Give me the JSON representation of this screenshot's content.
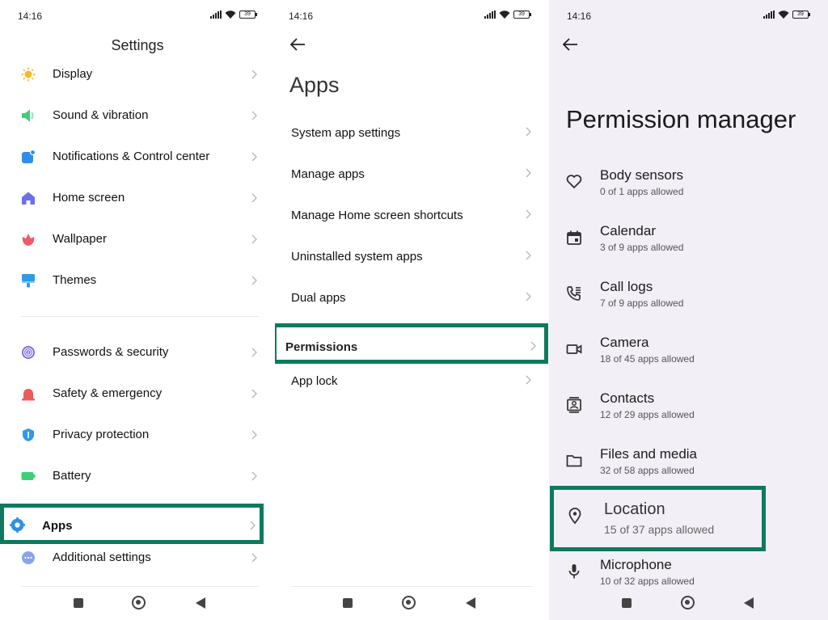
{
  "status": {
    "time": "14:16",
    "battery": "39"
  },
  "settings": {
    "title": "Settings",
    "items": [
      {
        "label": "Display",
        "icon": "sun-icon",
        "color": "#f5b82e"
      },
      {
        "label": "Sound & vibration",
        "icon": "speaker-icon",
        "color": "#3ccf7a"
      },
      {
        "label": "Notifications & Control center",
        "icon": "notification-icon",
        "color": "#2f8fe8"
      },
      {
        "label": "Home screen",
        "icon": "home-icon",
        "color": "#6b6fe8"
      },
      {
        "label": "Wallpaper",
        "icon": "flower-icon",
        "color": "#ef5a6a"
      },
      {
        "label": "Themes",
        "icon": "brush-icon",
        "color": "#2f9be8"
      },
      {
        "label": "Passwords & security",
        "icon": "fingerprint-icon",
        "color": "#7b6ee8"
      },
      {
        "label": "Safety & emergency",
        "icon": "alarm-icon",
        "color": "#ef5a5a"
      },
      {
        "label": "Privacy protection",
        "icon": "shield-icon",
        "color": "#2f9be8"
      },
      {
        "label": "Battery",
        "icon": "battery-icon",
        "color": "#3ccf7a"
      },
      {
        "label": "Apps",
        "icon": "gear-icon",
        "color": "#2f8fe8"
      },
      {
        "label": "Additional settings",
        "icon": "more-icon",
        "color": "#8aa4e8"
      }
    ]
  },
  "apps": {
    "title": "Apps",
    "items": [
      {
        "label": "System app settings"
      },
      {
        "label": "Manage apps"
      },
      {
        "label": "Manage Home screen shortcuts"
      },
      {
        "label": "Uninstalled system apps"
      },
      {
        "label": "Dual apps"
      },
      {
        "label": "Permissions"
      },
      {
        "label": "App lock"
      }
    ]
  },
  "permission_manager": {
    "title": "Permission manager",
    "items": [
      {
        "name": "Body sensors",
        "sub": "0 of 1 apps allowed",
        "icon": "heart-icon"
      },
      {
        "name": "Calendar",
        "sub": "3 of 9 apps allowed",
        "icon": "calendar-icon"
      },
      {
        "name": "Call logs",
        "sub": "7 of 9 apps allowed",
        "icon": "call-log-icon"
      },
      {
        "name": "Camera",
        "sub": "18 of 45 apps allowed",
        "icon": "camera-icon"
      },
      {
        "name": "Contacts",
        "sub": "12 of 29 apps allowed",
        "icon": "contacts-icon"
      },
      {
        "name": "Files and media",
        "sub": "32 of 58 apps allowed",
        "icon": "folder-icon"
      },
      {
        "name": "Location",
        "sub": "15 of 37 apps allowed",
        "icon": "location-icon"
      },
      {
        "name": "Microphone",
        "sub": "10 of 32 apps allowed",
        "icon": "microphone-icon"
      }
    ]
  },
  "colors": {
    "highlight": "#0d7a5f",
    "pm_background": "#f2eff6"
  }
}
